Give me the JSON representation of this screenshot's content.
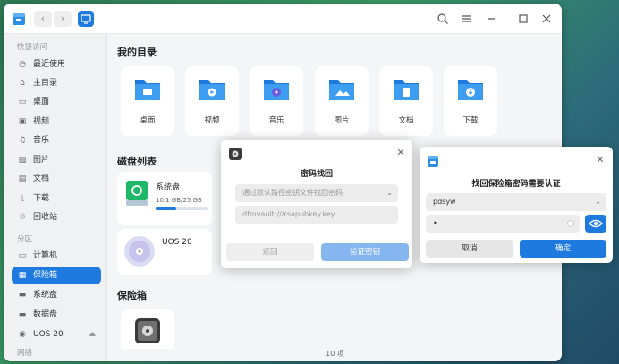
{
  "titlebar": {
    "back_label": "‹",
    "forward_label": "›"
  },
  "sidebar": {
    "quick_access_header": "快捷访问",
    "partitions_header": "分区",
    "network_header": "网络",
    "quick_items": [
      {
        "label": "最近使用",
        "icon": "clock-icon"
      },
      {
        "label": "主目录",
        "icon": "home-icon"
      },
      {
        "label": "桌面",
        "icon": "desktop-icon"
      },
      {
        "label": "视频",
        "icon": "video-icon"
      },
      {
        "label": "音乐",
        "icon": "music-icon"
      },
      {
        "label": "图片",
        "icon": "picture-icon"
      },
      {
        "label": "文档",
        "icon": "document-icon"
      },
      {
        "label": "下载",
        "icon": "download-icon"
      },
      {
        "label": "回收站",
        "icon": "trash-icon"
      }
    ],
    "partition_items": [
      {
        "label": "计算机",
        "icon": "computer-icon"
      },
      {
        "label": "保险箱",
        "icon": "vault-icon",
        "active": true
      },
      {
        "label": "系统盘",
        "icon": "disk-icon"
      },
      {
        "label": "数据盘",
        "icon": "disk-icon"
      },
      {
        "label": "UOS 20",
        "icon": "disc-icon"
      }
    ]
  },
  "main": {
    "my_directory_title": "我的目录",
    "folders": [
      {
        "label": "桌面",
        "icon": "desktop-folder-icon"
      },
      {
        "label": "视频",
        "icon": "video-folder-icon"
      },
      {
        "label": "音乐",
        "icon": "music-folder-icon"
      },
      {
        "label": "图片",
        "icon": "picture-folder-icon"
      },
      {
        "label": "文档",
        "icon": "document-folder-icon"
      },
      {
        "label": "下载",
        "icon": "download-folder-icon"
      }
    ],
    "disk_list_title": "磁盘列表",
    "system_disk": {
      "name": "系统盘",
      "usage": "10.1 GB/25 GB",
      "used_fraction": 0.4
    },
    "uos_disc": {
      "name": "UOS 20"
    },
    "vault_title": "保险箱",
    "status_text": "10 项"
  },
  "recover_dialog": {
    "title": "密码找回",
    "method_select": "通过默认路径密钥文件找回密码",
    "key_path": "dfmvault:///rsapubkey.key",
    "back_label": "返回",
    "verify_label": "验证密钥"
  },
  "auth_dialog": {
    "title": "找回保险箱密码需要认证",
    "username": "pdsyw",
    "password_mask": "•",
    "cancel_label": "取消",
    "confirm_label": "确定"
  },
  "colors": {
    "accent": "#1f7ae0",
    "folder_blue": "#2d8fe6"
  }
}
